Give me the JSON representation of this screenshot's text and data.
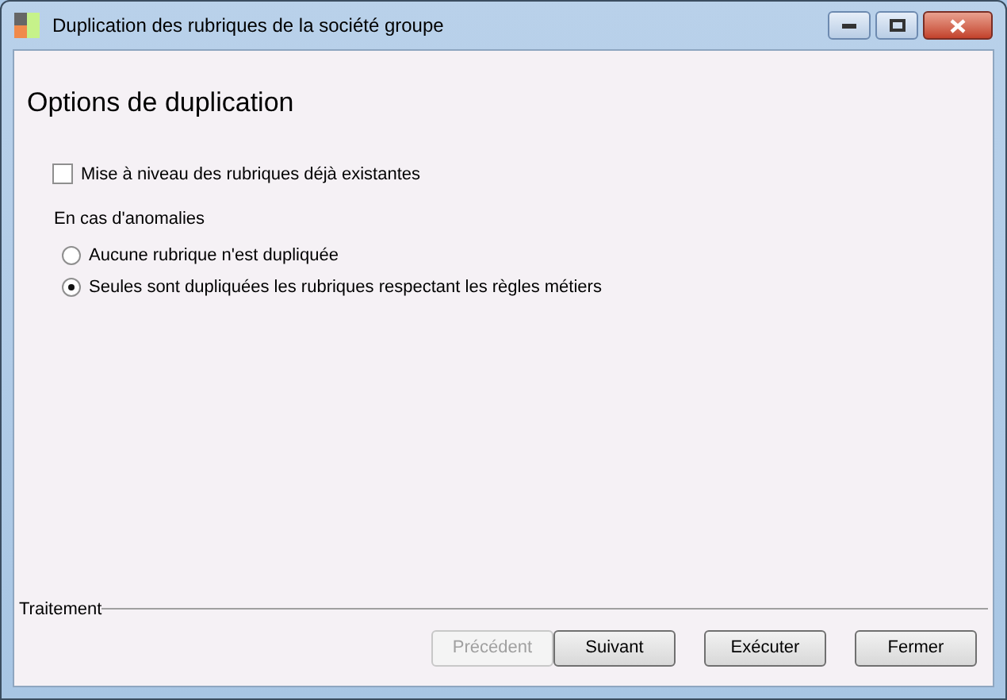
{
  "window": {
    "title": "Duplication des rubriques de la société groupe"
  },
  "heading": "Options de duplication",
  "upgrade_checkbox": {
    "label": "Mise à niveau des rubriques déjà existantes",
    "checked": false
  },
  "anomalies": {
    "label": "En cas d'anomalies",
    "options": [
      {
        "label": "Aucune rubrique n'est dupliquée",
        "selected": false
      },
      {
        "label": "Seules sont dupliquées les rubriques respectant les règles métiers",
        "selected": true
      }
    ]
  },
  "footer": {
    "label": "Traitement",
    "buttons": [
      {
        "label": "Précédent",
        "disabled": true
      },
      {
        "label": "Suivant",
        "disabled": false
      },
      {
        "label": "Exécuter",
        "disabled": false
      },
      {
        "label": "Fermer",
        "disabled": false
      }
    ]
  }
}
